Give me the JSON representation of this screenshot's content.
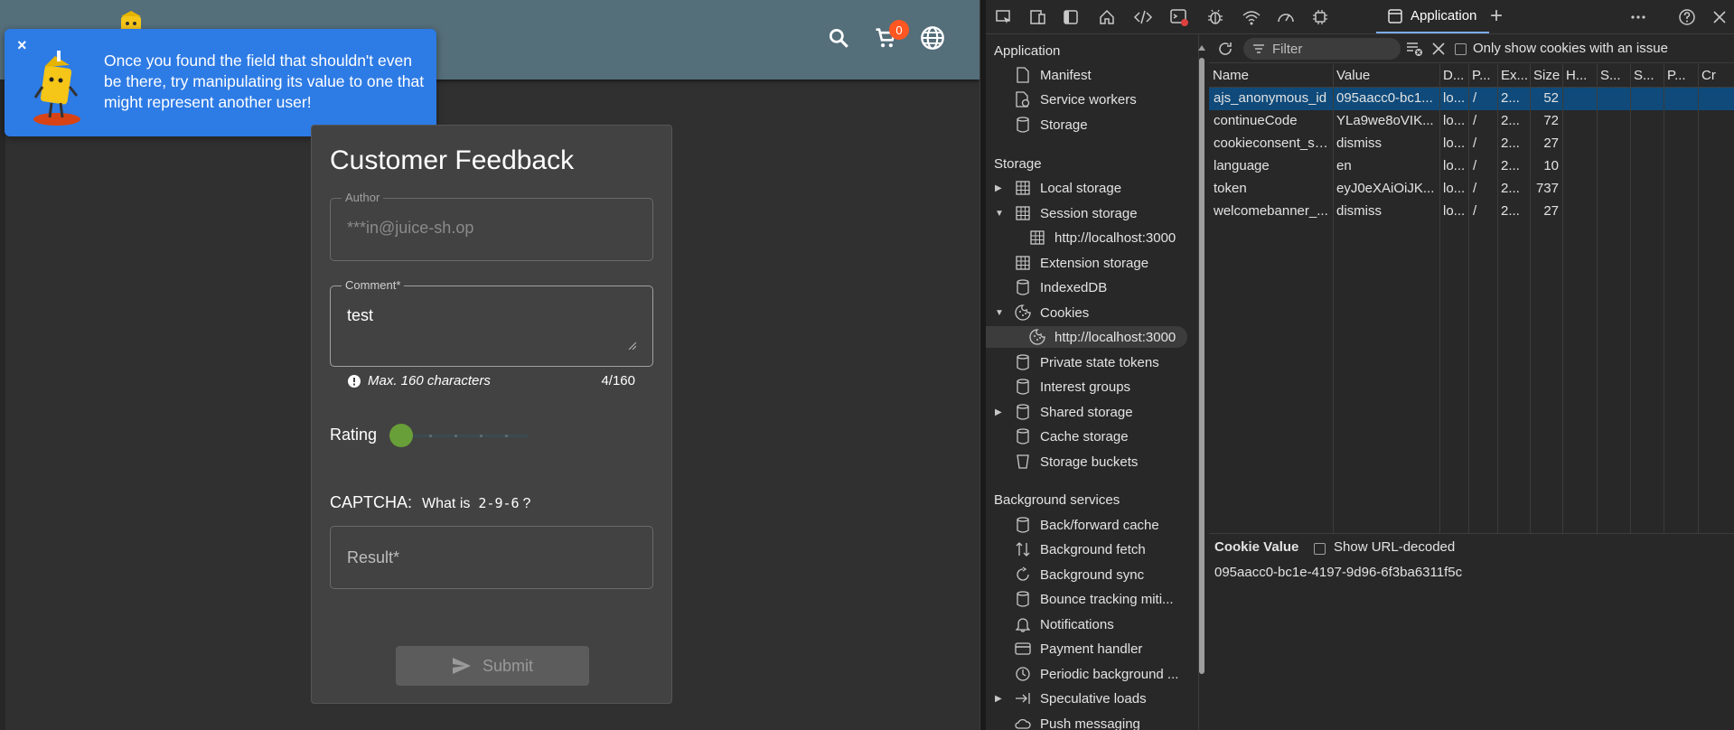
{
  "app": {
    "cart_count": "0",
    "toast": {
      "close": "×",
      "text": "Once you found the field that shouldn't even be there, try manipulating its value to one that might represent another user!"
    },
    "feedback": {
      "title": "Customer Feedback",
      "author_label": "Author",
      "author_value": "***in@juice-sh.op",
      "comment_label": "Comment*",
      "comment_value": "test",
      "hint": "Max. 160 characters",
      "count": "4/160",
      "rating_label": "Rating",
      "rating_value": 1,
      "rating_max": 5,
      "captcha_label": "CAPTCHA:",
      "captcha_question_prefix": "What is",
      "captcha_expression": "2-9-6",
      "captcha_question_suffix": "?",
      "result_placeholder": "Result*",
      "submit_label": "Submit"
    },
    "colors": {
      "toolbar": "#546e7a",
      "toast": "#2d7be5",
      "slider": "#689f38",
      "badge": "#ff5722"
    }
  },
  "devtools": {
    "active_tab": "Application",
    "sidebar": {
      "application_head": "Application",
      "application_items": [
        "Manifest",
        "Service workers",
        "Storage"
      ],
      "storage_head": "Storage",
      "storage_items": {
        "local_storage": "Local storage",
        "session_storage": "Session storage",
        "session_origin": "http://localhost:3000",
        "extension_storage": "Extension storage",
        "indexeddb": "IndexedDB",
        "cookies": "Cookies",
        "cookies_origin": "http://localhost:3000",
        "private_state_tokens": "Private state tokens",
        "interest_groups": "Interest groups",
        "shared_storage": "Shared storage",
        "cache_storage": "Cache storage",
        "storage_buckets": "Storage buckets"
      },
      "background_head": "Background services",
      "background_items": [
        "Back/forward cache",
        "Background fetch",
        "Background sync",
        "Bounce tracking miti...",
        "Notifications",
        "Payment handler",
        "Periodic background ...",
        "Speculative loads",
        "Push messaging"
      ]
    },
    "toolbar": {
      "filter_placeholder": "Filter",
      "only_issue_label": "Only show cookies with an issue"
    },
    "columns": [
      "Name",
      "Value",
      "D...",
      "P...",
      "Ex...",
      "Size",
      "H...",
      "S...",
      "S...",
      "P...",
      "Cr"
    ],
    "rows": [
      {
        "name": "ajs_anonymous_id",
        "value": "095aacc0-bc1...",
        "domain": "lo...",
        "path": "/",
        "expires": "2...",
        "size": "52"
      },
      {
        "name": "continueCode",
        "value": "YLa9we8oVIK...",
        "domain": "lo...",
        "path": "/",
        "expires": "2...",
        "size": "72"
      },
      {
        "name": "cookieconsent_st...",
        "value": "dismiss",
        "domain": "lo...",
        "path": "/",
        "expires": "2...",
        "size": "27"
      },
      {
        "name": "language",
        "value": "en",
        "domain": "lo...",
        "path": "/",
        "expires": "2...",
        "size": "10"
      },
      {
        "name": "token",
        "value": "eyJ0eXAiOiJK...",
        "domain": "lo...",
        "path": "/",
        "expires": "2...",
        "size": "737"
      },
      {
        "name": "welcomebanner_...",
        "value": "dismiss",
        "domain": "lo...",
        "path": "/",
        "expires": "2...",
        "size": "27"
      }
    ],
    "cookie_value": {
      "title": "Cookie Value",
      "decode_label": "Show URL-decoded",
      "value": "095aacc0-bc1e-4197-9d96-6f3ba6311f5c"
    }
  }
}
